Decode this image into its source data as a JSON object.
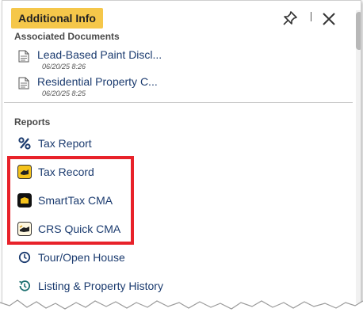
{
  "header": {
    "title": "Additional Info",
    "accent_color": "#f5c74a"
  },
  "toolbar": {
    "pin_icon": "pin-icon",
    "close_icon": "close-icon"
  },
  "associated_documents": {
    "title": "Associated Documents",
    "items": [
      {
        "name": "Lead-Based Paint Discl...",
        "date": "06/20/25 8:26"
      },
      {
        "name": "Residential Property C...",
        "date": "06/20/25 8:25"
      }
    ]
  },
  "reports": {
    "title": "Reports",
    "items": [
      {
        "label": "Tax Report",
        "icon": "percent-icon"
      },
      {
        "label": "Tax Record",
        "icon": "tax-record-icon"
      },
      {
        "label": "SmartTax CMA",
        "icon": "smarttax-icon"
      },
      {
        "label": "CRS Quick CMA",
        "icon": "crs-icon"
      },
      {
        "label": "Tour/Open House",
        "icon": "clock-icon"
      },
      {
        "label": "Listing & Property History",
        "icon": "history-icon"
      }
    ]
  },
  "highlight_color": "#e8222a"
}
